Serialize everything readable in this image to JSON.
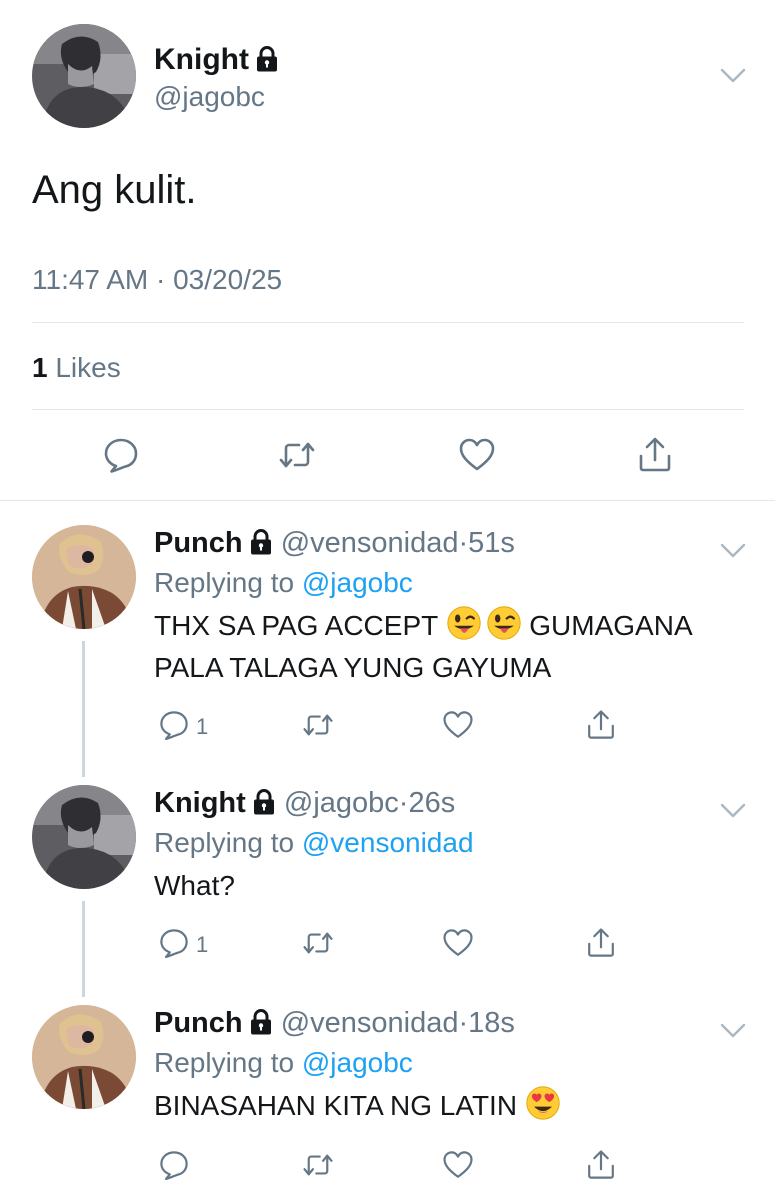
{
  "main_tweet": {
    "author_name": "Knight",
    "author_handle": "@jagobc",
    "text": "Ang kulit.",
    "timestamp": "11:47 AM · 03/20/25",
    "likes_count": "1",
    "likes_label": "Likes",
    "icons": [
      "comment-icon",
      "retweet-icon",
      "heart-icon",
      "share-icon"
    ]
  },
  "replies": [
    {
      "author_name": "Punch",
      "author_handle": "@vensonidad",
      "separator": "·",
      "time": "51s",
      "replying_prefix": "Replying to",
      "replying_to": "@jagobc",
      "text_line1": "THX SA PAG ACCEPT",
      "text_line1b": "GUMAGANA",
      "text_line2": "PALA TALAGA YUNG GAYUMA",
      "emojis": [
        "winking-face-with-tongue",
        "winking-face-with-tongue"
      ],
      "reply_count": "1"
    },
    {
      "author_name": "Knight",
      "author_handle": "@jagobc",
      "separator": "·",
      "time": "26s",
      "replying_prefix": "Replying to",
      "replying_to": "@vensonidad",
      "text": "What?",
      "reply_count": "1"
    },
    {
      "author_name": "Punch",
      "author_handle": "@vensonidad",
      "separator": "·",
      "time": "18s",
      "replying_prefix": "Replying to",
      "replying_to": "@jagobc",
      "text": "BINASAHAN KITA NG LATIN",
      "emojis": [
        "smiling-face-with-heart-eyes"
      ]
    }
  ],
  "colors": {
    "text": "#14171a",
    "secondary": "#657786",
    "link": "#1da1f2",
    "divider": "#e1e8ed",
    "thread_line": "#ccd6dd"
  }
}
